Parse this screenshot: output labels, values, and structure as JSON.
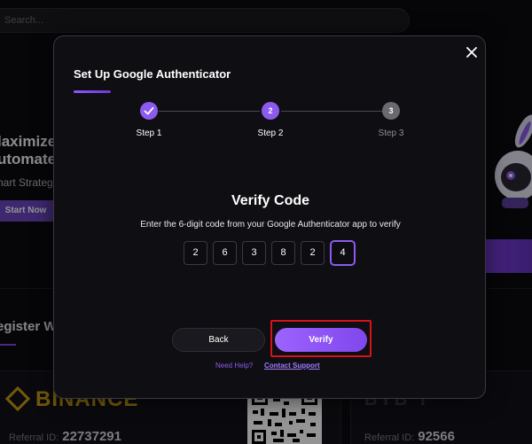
{
  "background": {
    "search_placeholder": "Search...",
    "hero_title_line1": "laximize",
    "hero_title_line2": "utomate",
    "hero_subtitle": "nart Strateg",
    "start_button": "Start Now",
    "register_heading": "egister W",
    "binance_logo": "BINANCE",
    "binance_referral_label": "Referral ID:",
    "binance_referral_id": "22737291",
    "bybit_logo": "BYB T",
    "bybit_referral_label": "Referral ID:",
    "bybit_referral_id": "92566"
  },
  "modal": {
    "title": "Set Up Google Authenticator",
    "close_icon": "close-icon",
    "steps": [
      {
        "number": "1",
        "label": "Step 1",
        "state": "completed"
      },
      {
        "number": "2",
        "label": "Step 2",
        "state": "active"
      },
      {
        "number": "3",
        "label": "Step 3",
        "state": "pending"
      }
    ],
    "verify_title": "Verify Code",
    "verify_description": "Enter the 6-digit code from your Google Authenticator app to verify",
    "code_digits": [
      "2",
      "6",
      "3",
      "8",
      "2",
      "4"
    ],
    "back_button": "Back",
    "verify_button": "Verify",
    "help_text": "Need Help?",
    "help_link": "Contact Support"
  },
  "colors": {
    "accent": "#8c5aee",
    "highlight": "#d6121a",
    "binance_gold": "#c49b13"
  }
}
